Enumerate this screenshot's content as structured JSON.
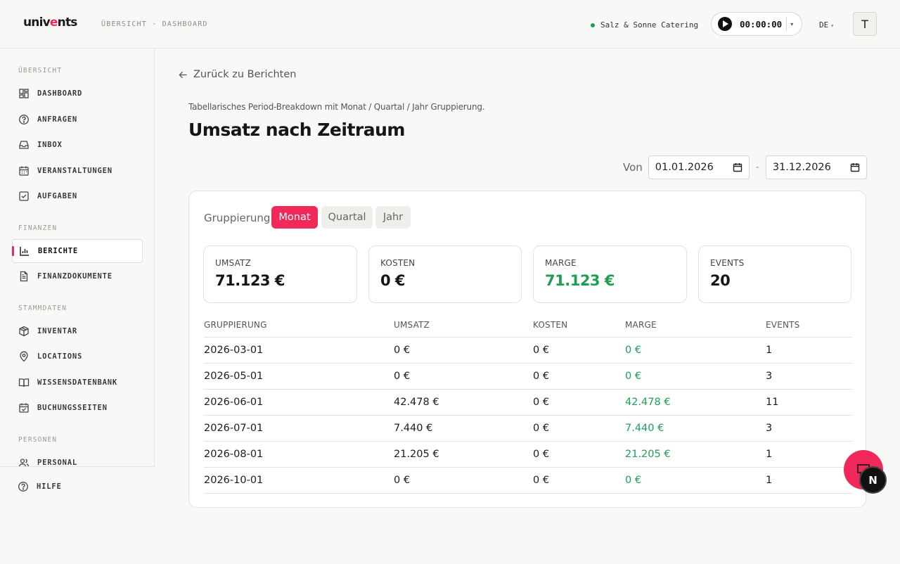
{
  "header": {
    "logo_text_a": "univ",
    "logo_text_b": "e",
    "logo_text_c": "nts",
    "breadcrumb": "ÜBERSICHT · DASHBOARD",
    "tenant": "Salz & Sonne Catering",
    "timer": "00:00:00",
    "language": "DE",
    "avatar_initial": "T"
  },
  "sidebar": {
    "sections": [
      {
        "label": "ÜBERSICHT"
      },
      {
        "label": "FINANZEN"
      },
      {
        "label": "STAMMDATEN"
      },
      {
        "label": "PERSONEN"
      }
    ],
    "items": [
      {
        "label": "DASHBOARD",
        "icon": "dashboard-icon"
      },
      {
        "label": "ANFRAGEN",
        "icon": "help-circle-icon"
      },
      {
        "label": "INBOX",
        "icon": "inbox-icon"
      },
      {
        "label": "VERANSTALTUNGEN",
        "icon": "calendar-icon"
      },
      {
        "label": "AUFGABEN",
        "icon": "checkbox-icon"
      },
      {
        "label": "BERICHTE",
        "icon": "bar-chart-icon",
        "active": true
      },
      {
        "label": "FINANZDOKUMENTE",
        "icon": "document-icon"
      },
      {
        "label": "INVENTAR",
        "icon": "box-icon"
      },
      {
        "label": "LOCATIONS",
        "icon": "map-pin-icon"
      },
      {
        "label": "WISSENSDATENBANK",
        "icon": "book-icon"
      },
      {
        "label": "BUCHUNGSSEITEN",
        "icon": "calendar-check-icon"
      },
      {
        "label": "PERSONAL",
        "icon": "users-icon"
      }
    ],
    "help": {
      "label": "HILFE",
      "icon": "help-circle-icon"
    }
  },
  "main": {
    "back_label": "Zurück zu Berichten",
    "subtitle": "Tabellarisches Period-Breakdown mit Monat / Quartal / Jahr Gruppierung.",
    "title": "Umsatz nach Zeitraum",
    "range": {
      "from_label": "Von",
      "from": "01.01.2026",
      "separator": "-",
      "to": "31.12.2026"
    },
    "grouping": {
      "label": "Gruppierung",
      "options": [
        "Monat",
        "Quartal",
        "Jahr"
      ],
      "selected": "Monat"
    },
    "kpis": [
      {
        "label": "UMSATZ",
        "value": "71.123 €"
      },
      {
        "label": "KOSTEN",
        "value": "0 €"
      },
      {
        "label": "MARGE",
        "value": "71.123 €"
      },
      {
        "label": "EVENTS",
        "value": "20"
      }
    ],
    "table": {
      "columns": [
        "GRUPPIERUNG",
        "UMSATZ",
        "KOSTEN",
        "MARGE",
        "EVENTS"
      ],
      "rows": [
        [
          "2026-03-01",
          "0 €",
          "0 €",
          "0 €",
          "1"
        ],
        [
          "2026-05-01",
          "0 €",
          "0 €",
          "0 €",
          "3"
        ],
        [
          "2026-06-01",
          "42.478 €",
          "0 €",
          "42.478 €",
          "11"
        ],
        [
          "2026-07-01",
          "7.440 €",
          "0 €",
          "7.440 €",
          "3"
        ],
        [
          "2026-08-01",
          "21.205 €",
          "0 €",
          "21.205 €",
          "1"
        ],
        [
          "2026-10-01",
          "0 €",
          "0 €",
          "0 €",
          "1"
        ]
      ]
    }
  },
  "fab": {
    "badge_letter": "N"
  },
  "colors": {
    "accent": "#f0295a",
    "positive": "#1f9d55"
  }
}
